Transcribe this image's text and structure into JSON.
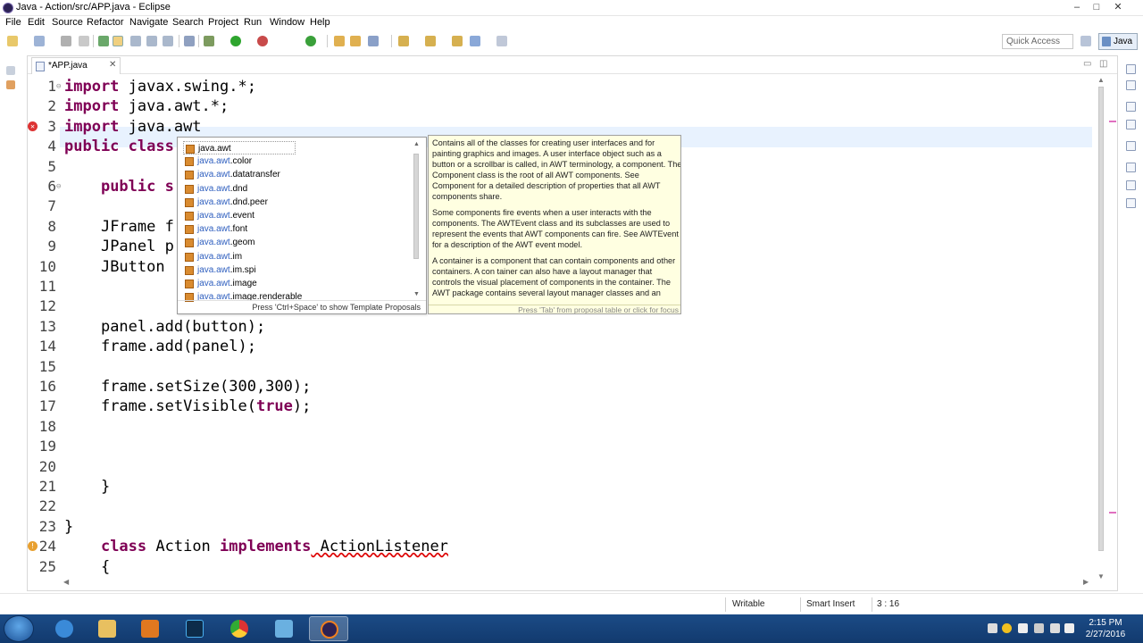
{
  "window": {
    "title": "Java - Action/src/APP.java - Eclipse",
    "controls": [
      "–",
      "□",
      "✕"
    ]
  },
  "menu": [
    "File",
    "Edit",
    "Source",
    "Refactor",
    "Navigate",
    "Search",
    "Project",
    "Run",
    "Window",
    "Help"
  ],
  "toolbar": {
    "quick_access": "Quick Access",
    "perspective": "Java"
  },
  "editor": {
    "tab_label": "*APP.java",
    "code_lines": [
      {
        "n": "1",
        "pre": "",
        "kw": "import",
        "rest": " javax.swing.*;"
      },
      {
        "n": "2",
        "pre": "",
        "kw": "import",
        "rest": " java.awt.*;"
      },
      {
        "n": "3",
        "pre": "",
        "kw": "import",
        "rest": " java.awt"
      },
      {
        "n": "4",
        "pre": "",
        "kw": "public class",
        "rest": ""
      },
      {
        "n": "5",
        "pre": "",
        "kw": "",
        "rest": ""
      },
      {
        "n": "6",
        "pre": "    ",
        "kw": "public s",
        "rest": ""
      },
      {
        "n": "7",
        "pre": "",
        "kw": "",
        "rest": ""
      },
      {
        "n": "8",
        "pre": "    ",
        "kw": "",
        "rest": "JFrame f"
      },
      {
        "n": "9",
        "pre": "    ",
        "kw": "",
        "rest": "JPanel p"
      },
      {
        "n": "10",
        "pre": "    ",
        "kw": "",
        "rest": "JButton"
      },
      {
        "n": "11",
        "pre": "",
        "kw": "",
        "rest": ""
      },
      {
        "n": "12",
        "pre": "",
        "kw": "",
        "rest": ""
      },
      {
        "n": "13",
        "pre": "    ",
        "kw": "",
        "rest": "panel.add(button);"
      },
      {
        "n": "14",
        "pre": "    ",
        "kw": "",
        "rest": "frame.add(panel);"
      },
      {
        "n": "15",
        "pre": "",
        "kw": "",
        "rest": ""
      },
      {
        "n": "16",
        "pre": "    ",
        "kw": "",
        "rest": "frame.setSize(300,300);"
      },
      {
        "n": "17",
        "pre": "    ",
        "kw": "",
        "rest": "frame.setVisible(",
        "kw2": "true",
        "rest2": ");"
      },
      {
        "n": "18",
        "pre": "",
        "kw": "",
        "rest": ""
      },
      {
        "n": "19",
        "pre": "",
        "kw": "",
        "rest": ""
      },
      {
        "n": "20",
        "pre": "",
        "kw": "",
        "rest": ""
      },
      {
        "n": "21",
        "pre": "    ",
        "kw": "",
        "rest": "}"
      },
      {
        "n": "22",
        "pre": "",
        "kw": "",
        "rest": ""
      },
      {
        "n": "23",
        "pre": "",
        "kw": "",
        "rest": "}"
      },
      {
        "n": "24",
        "pre": "    ",
        "kw": "class",
        "rest": " Action ",
        "kw2": "implements",
        "rest2": " ActionListener"
      },
      {
        "n": "25",
        "pre": "    ",
        "kw": "",
        "rest": "{"
      }
    ]
  },
  "content_assist": {
    "prefix": "java.awt",
    "items": [
      {
        "prefix": "java.awt",
        "suffix": ""
      },
      {
        "prefix": "java.awt",
        "suffix": ".color"
      },
      {
        "prefix": "java.awt",
        "suffix": ".datatransfer"
      },
      {
        "prefix": "java.awt",
        "suffix": ".dnd"
      },
      {
        "prefix": "java.awt",
        "suffix": ".dnd.peer"
      },
      {
        "prefix": "java.awt",
        "suffix": ".event"
      },
      {
        "prefix": "java.awt",
        "suffix": ".font"
      },
      {
        "prefix": "java.awt",
        "suffix": ".geom"
      },
      {
        "prefix": "java.awt",
        "suffix": ".im"
      },
      {
        "prefix": "java.awt",
        "suffix": ".im.spi"
      },
      {
        "prefix": "java.awt",
        "suffix": ".image"
      },
      {
        "prefix": "java.awt",
        "suffix": ".image.renderable"
      }
    ],
    "footer": "Press 'Ctrl+Space' to show Template Proposals"
  },
  "javadoc": {
    "paragraphs": [
      "Contains all of the classes for creating user interfaces and for painting graphics and images. A user interface object such as a button or a scrollbar is called, in AWT terminology, a component. The Component class is the root of all AWT components. See Component for a detailed description of properties that all AWT components share.",
      "Some components fire events when a user interacts with the components. The AWTEvent class and its subclasses are used to represent the events that AWT components can fire. See AWTEvent for a description of the AWT event model.",
      "A container is a component that can contain components and other containers. A con tainer can also have a layout manager that controls the visual placement of components in the container. The AWT package contains several layout manager classes and an"
    ],
    "footer": "Press 'Tab' from proposal table or click for focus"
  },
  "status": {
    "writable": "Writable",
    "insert_mode": "Smart Insert",
    "position": "3 : 16"
  },
  "taskbar": {
    "time": "2:15 PM",
    "date": "2/27/2016"
  }
}
